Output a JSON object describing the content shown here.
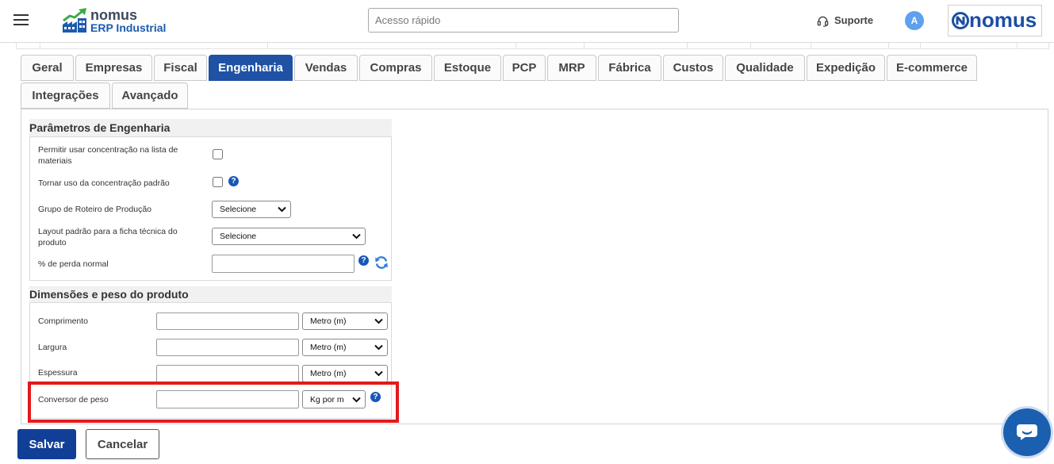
{
  "header": {
    "logo_brand": "nomus",
    "logo_product": "ERP Industrial",
    "search_placeholder": "Acesso rápido",
    "support_label": "Suporte",
    "avatar_initial": "A",
    "company_logo_text": "nomus"
  },
  "tabs": {
    "row1": [
      {
        "label": "Geral"
      },
      {
        "label": "Empresas"
      },
      {
        "label": "Fiscal"
      },
      {
        "label": "Engenharia",
        "active": true
      },
      {
        "label": "Vendas"
      },
      {
        "label": "Compras"
      },
      {
        "label": "Estoque"
      },
      {
        "label": "PCP"
      },
      {
        "label": "MRP"
      },
      {
        "label": "Fábrica"
      },
      {
        "label": "Custos"
      },
      {
        "label": "Qualidade"
      },
      {
        "label": "Expedição"
      },
      {
        "label": "E-commerce"
      }
    ],
    "row2": [
      {
        "label": "Integrações"
      },
      {
        "label": "Avançado"
      }
    ]
  },
  "engineering": {
    "title": "Parâmetros de Engenharia",
    "allow_concentration": {
      "label": "Permitir usar concentração na lista de materiais",
      "checked": false
    },
    "default_concentration": {
      "label": "Tornar uso da concentração padrão",
      "checked": false
    },
    "routing_group": {
      "label": "Grupo de Roteiro de Produção",
      "selected": "Selecione"
    },
    "datasheet_layout": {
      "label": "Layout padrão para a ficha técnica do produto",
      "selected": "Selecione"
    },
    "normal_loss": {
      "label": "% de perda normal",
      "value": ""
    }
  },
  "dimensions": {
    "title": "Dimensões e peso do produto",
    "fields": [
      {
        "label": "Comprimento",
        "value": "",
        "unit": "Metro (m)"
      },
      {
        "label": "Largura",
        "value": "",
        "unit": "Metro (m)"
      },
      {
        "label": "Espessura",
        "value": "",
        "unit": "Metro (m)"
      },
      {
        "label": "Conversor de peso",
        "value": "",
        "unit": "Kg por m"
      }
    ]
  },
  "actions": {
    "save_label": "Salvar",
    "cancel_label": "Cancelar"
  },
  "colors": {
    "primary": "#1f51a5",
    "save_button": "#113f97",
    "highlight": "#e3191c",
    "help_icon": "#1a56b8",
    "avatar": "#5ea1ee",
    "chat_widget": "#1a5fb0",
    "refresh_icon": "#2b7fd8",
    "logo_blue": "#1d5aae",
    "logo_green": "#3daa45"
  },
  "icons": {
    "menu": "menu-icon",
    "logo": "factory-growth-icon",
    "support": "headset-icon",
    "company": "nomus-n-icon",
    "help": "question-circle-icon",
    "refresh": "refresh-icon",
    "select": "chevron-down-icon",
    "chat": "chat-bubble-icon"
  }
}
